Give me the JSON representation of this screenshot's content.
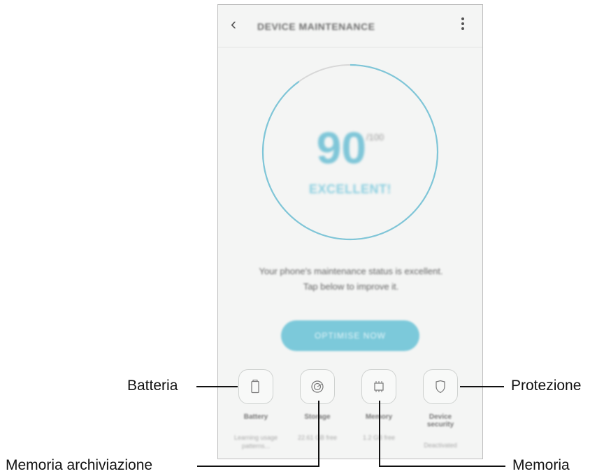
{
  "header": {
    "title": "DEVICE MAINTENANCE",
    "back_icon": "chevron-left-icon",
    "menu_icon": "more-vertical-icon"
  },
  "score": {
    "value": "90",
    "max": "/100",
    "status": "EXCELLENT!",
    "fraction": 0.9
  },
  "colors": {
    "accent": "#7fc6d8",
    "ring_track": "#d8d8d8"
  },
  "message": {
    "line1": "Your phone's maintenance status is excellent.",
    "line2": "Tap below to improve it."
  },
  "optimize_button": {
    "label": "OPTIMISE NOW"
  },
  "tools": [
    {
      "label": "Battery",
      "sub": "Learning usage patterns...",
      "icon": "battery-icon"
    },
    {
      "label": "Storage",
      "sub": "22.61 GB free",
      "icon": "storage-icon"
    },
    {
      "label": "Memory",
      "sub": "1.2 GB free",
      "icon": "memory-icon"
    },
    {
      "label": "Device security",
      "sub": "Deactivated",
      "icon": "shield-icon"
    }
  ],
  "callouts": {
    "battery": "Batteria",
    "storage": "Memoria archiviazione",
    "memory": "Memoria",
    "security": "Protezione"
  }
}
